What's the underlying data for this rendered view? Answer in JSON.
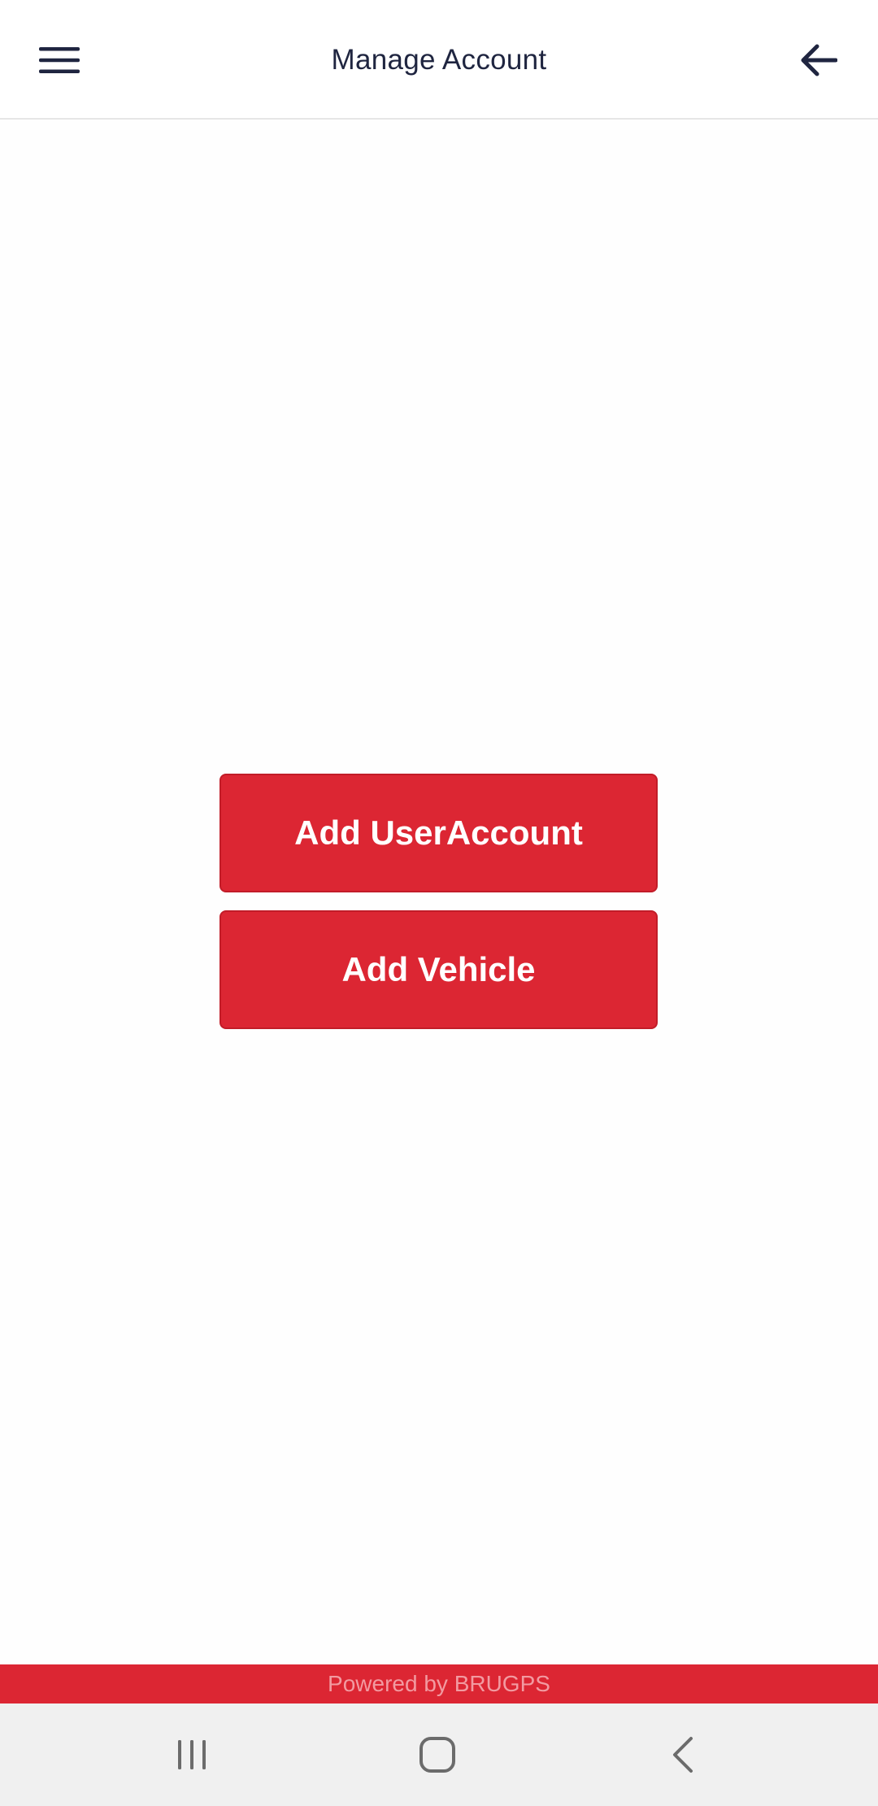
{
  "header": {
    "title": "Manage Account",
    "menu_icon": "hamburger-menu-icon",
    "back_icon": "arrow-left-icon"
  },
  "main": {
    "buttons": [
      {
        "label": "Add UserAccount"
      },
      {
        "label": "Add Vehicle"
      }
    ]
  },
  "footer": {
    "text": "Powered by BRUGPS"
  },
  "system_nav": {
    "recents_icon": "recent-apps-icon",
    "home_icon": "home-icon",
    "back_icon": "back-chevron-icon"
  },
  "colors": {
    "accent": "#dc2633",
    "header_text": "#1f2540",
    "nav_bar_bg": "#f0f0f0"
  }
}
